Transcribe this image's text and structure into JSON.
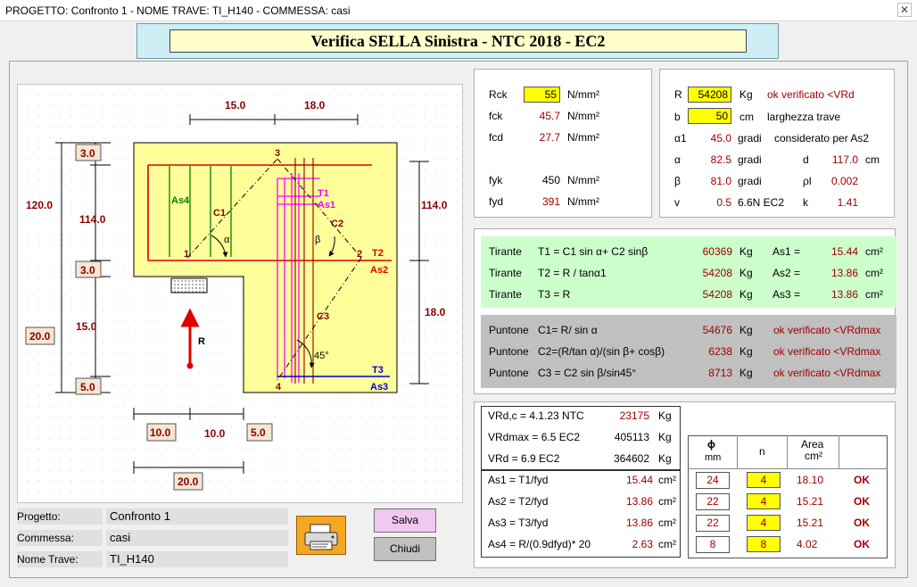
{
  "window": {
    "title": "PROGETTO: Confronto 1 - NOME TRAVE: TI_H140 - COMMESSA: casi",
    "close_glyph": "✕"
  },
  "header": {
    "title": "Verifica SELLA Sinistra - NTC 2018 - EC2"
  },
  "drawing": {
    "dim_15_top": "15.0",
    "dim_18_top": "18.0",
    "dim_120": "120.0",
    "dim_114_left": "114.0",
    "dim_114_right": "114.0",
    "box_3_top": "3.0",
    "box_3_mid": "3.0",
    "box_5": "5.0",
    "box_20_left": "20.0",
    "dim_15_left": "15.0",
    "dim_18_right": "18.0",
    "box_10": "10.0",
    "dim_10": "10.0",
    "box_5_bottom": "5.0",
    "box_20_bottom": "20.0",
    "lbl_as4": "As4",
    "lbl_c1": "C1",
    "lbl_c2": "C2",
    "lbl_c3": "C3",
    "lbl_t1": "T1",
    "lbl_as1": "As1",
    "lbl_t2": "T2",
    "lbl_as2": "As2",
    "lbl_t3": "T3",
    "lbl_as3": "As3",
    "lbl_r": "R",
    "lbl_alpha": "α",
    "lbl_beta": "β",
    "lbl_45": "45°",
    "n1": "1",
    "n2": "2",
    "n3": "3",
    "n4": "4"
  },
  "materials": {
    "rck_label": "Rck",
    "rck_value": "55",
    "rck_unit": "N/mm²",
    "fck_label": "fck",
    "fck_value": "45.7",
    "fck_unit": "N/mm²",
    "fcd_label": "fcd",
    "fcd_value": "27.7",
    "fcd_unit": "N/mm²",
    "fyk_label": "fyk",
    "fyk_value": "450",
    "fyk_unit": "N/mm²",
    "fyd_label": "fyd",
    "fyd_value": "391",
    "fyd_unit": "N/mm²"
  },
  "geometry": {
    "r_label": "R",
    "r_value": "54208",
    "r_unit": "Kg",
    "r_status": "ok verificato <VRd",
    "b_label": "b",
    "b_value": "50",
    "b_unit": "cm",
    "b_note": "larghezza trave",
    "a1_label": "α1",
    "a1_value": "45.0",
    "a1_unit": "gradi",
    "a1_note": "considerato per As2",
    "a_label": "α",
    "a_value": "82.5",
    "a_unit": "gradi",
    "d_label": "d",
    "d_value": "117.0",
    "d_unit": "cm",
    "beta_label": "β",
    "beta_value": "81.0",
    "beta_unit": "gradi",
    "rho_label": "ρl",
    "rho_value": "0.002",
    "v_label": "v",
    "v_value": "0.5",
    "v_note": "6.6N EC2",
    "k_label": "k",
    "k_value": "1.41"
  },
  "tiranti": [
    {
      "name": "Tirante",
      "formula": "T1 = C1 sin  α+ C2 sinβ",
      "value": "60369",
      "unit": "Kg",
      "as_label": "As1 =",
      "as_value": "15.44",
      "as_unit": "cm²"
    },
    {
      "name": "Tirante",
      "formula": "T2 = R  / tanα1",
      "value": "54208",
      "unit": "Kg",
      "as_label": "As2 =",
      "as_value": "13.86",
      "as_unit": "cm²"
    },
    {
      "name": "Tirante",
      "formula": "T3 = R",
      "value": "54208",
      "unit": "Kg",
      "as_label": "As3 =",
      "as_value": "13.86",
      "as_unit": "cm²"
    }
  ],
  "puntoni": [
    {
      "name": "Puntone",
      "formula": "C1= R/ sin   α",
      "value": "54676",
      "unit": "Kg",
      "status": "ok verificato <VRdmax"
    },
    {
      "name": "Puntone",
      "formula": "C2=(R/tan α)/(sin β+ cosβ)",
      "value": "6238",
      "unit": "Kg",
      "status": "ok verificato <VRdmax"
    },
    {
      "name": "Puntone",
      "formula": "C3 = C2 sin β/sin45°",
      "value": "8713",
      "unit": "Kg",
      "status": "ok verificato <VRdmax"
    }
  ],
  "resist": [
    {
      "label": "VRd,c = 4.1.23 NTC",
      "value": "23175",
      "unit": "Kg"
    },
    {
      "label": "VRdmax = 6.5 EC2",
      "value": "405113",
      "unit": "Kg"
    },
    {
      "label": "VRd = 6.9 EC2",
      "value": "364602",
      "unit": "Kg"
    }
  ],
  "as_req": [
    {
      "label": "As1 = T1/fyd",
      "value": "15.44",
      "unit": "cm²"
    },
    {
      "label": "As2 = T2/fyd",
      "value": "13.86",
      "unit": "cm²"
    },
    {
      "label": "As3 = T3/fyd",
      "value": "13.86",
      "unit": "cm²"
    },
    {
      "label": "As4 = R/(0.9dfyd)*  20",
      "value": "2.63",
      "unit": "cm²"
    }
  ],
  "bars": {
    "head_phi": "ϕ",
    "head_mm": "mm",
    "head_n": "n",
    "head_area": "Area",
    "head_area_unit": "cm²",
    "rows": [
      {
        "mm": "24",
        "n": "4",
        "area": "18.10",
        "ok": "OK"
      },
      {
        "mm": "22",
        "n": "4",
        "area": "15.21",
        "ok": "OK"
      },
      {
        "mm": "22",
        "n": "4",
        "area": "15.21",
        "ok": "OK"
      },
      {
        "mm": "8",
        "n": "8",
        "area": "4.02",
        "ok": "OK"
      }
    ]
  },
  "info": {
    "progetto_label": "Progetto:",
    "progetto_value": "Confronto 1",
    "commessa_label": "Commessa:",
    "commessa_value": "casi",
    "trave_label": "Nome Trave:",
    "trave_value": "TI_H140"
  },
  "buttons": {
    "salva": "Salva",
    "chiudi": "Chiudi"
  }
}
